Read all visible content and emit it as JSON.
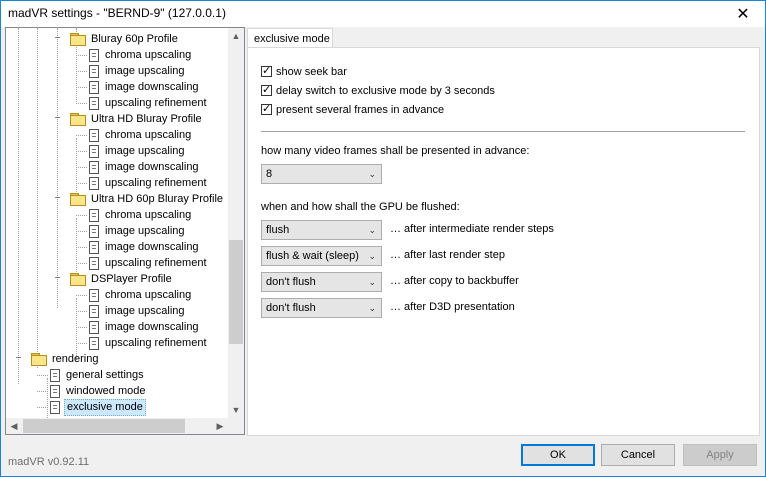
{
  "window": {
    "title": "madVR settings - \"BERND-9\" (127.0.0.1)",
    "close_glyph": "✕"
  },
  "tree": [
    {
      "label": "Bluray 60p Profile",
      "type": "folder",
      "level": 2,
      "toggle": "−"
    },
    {
      "label": "chroma upscaling",
      "type": "page",
      "level": 3
    },
    {
      "label": "image upscaling",
      "type": "page",
      "level": 3
    },
    {
      "label": "image downscaling",
      "type": "page",
      "level": 3
    },
    {
      "label": "upscaling refinement",
      "type": "page",
      "level": 3
    },
    {
      "label": "Ultra HD Bluray Profile",
      "type": "folder",
      "level": 2,
      "toggle": "−"
    },
    {
      "label": "chroma upscaling",
      "type": "page",
      "level": 3
    },
    {
      "label": "image upscaling",
      "type": "page",
      "level": 3
    },
    {
      "label": "image downscaling",
      "type": "page",
      "level": 3
    },
    {
      "label": "upscaling refinement",
      "type": "page",
      "level": 3
    },
    {
      "label": "Ultra HD 60p Bluray Profile",
      "type": "folder",
      "level": 2,
      "toggle": "−"
    },
    {
      "label": "chroma upscaling",
      "type": "page",
      "level": 3
    },
    {
      "label": "image upscaling",
      "type": "page",
      "level": 3
    },
    {
      "label": "image downscaling",
      "type": "page",
      "level": 3
    },
    {
      "label": "upscaling refinement",
      "type": "page",
      "level": 3
    },
    {
      "label": "DSPlayer Profile",
      "type": "folder",
      "level": 2,
      "toggle": "−"
    },
    {
      "label": "chroma upscaling",
      "type": "page",
      "level": 3
    },
    {
      "label": "image upscaling",
      "type": "page",
      "level": 3
    },
    {
      "label": "image downscaling",
      "type": "page",
      "level": 3
    },
    {
      "label": "upscaling refinement",
      "type": "page",
      "level": 3
    },
    {
      "label": "rendering",
      "type": "folder",
      "level": 0,
      "toggle": "−"
    },
    {
      "label": "general settings",
      "type": "page",
      "level": 1
    },
    {
      "label": "windowed mode",
      "type": "page",
      "level": 1
    },
    {
      "label": "exclusive mode",
      "type": "page",
      "level": 1,
      "selected": true
    }
  ],
  "scroll": {
    "up": "▲",
    "down": "▼",
    "left": "◀",
    "right": "▶"
  },
  "tab": {
    "label": "exclusive mode"
  },
  "options": {
    "show_seek_bar": {
      "label": "show seek bar",
      "checked": true
    },
    "delay_switch": {
      "label": "delay switch to exclusive mode by 3 seconds",
      "checked": true
    },
    "present_frames": {
      "label": "present several frames in advance",
      "checked": true
    }
  },
  "frames": {
    "label": "how many video frames shall be presented in advance:",
    "value": "8"
  },
  "flush": {
    "label": "when and how shall the GPU be flushed:",
    "rows": [
      {
        "value": "flush",
        "after": "… after intermediate render steps"
      },
      {
        "value": "flush & wait (sleep)",
        "after": "… after last render step"
      },
      {
        "value": "don't flush",
        "after": "… after copy to backbuffer"
      },
      {
        "value": "don't flush",
        "after": "… after D3D presentation"
      }
    ]
  },
  "footer": {
    "version": "madVR v0.92.11",
    "ok": "OK",
    "cancel": "Cancel",
    "apply": "Apply"
  },
  "icons": {
    "chevron": "chevron-down-icon"
  }
}
